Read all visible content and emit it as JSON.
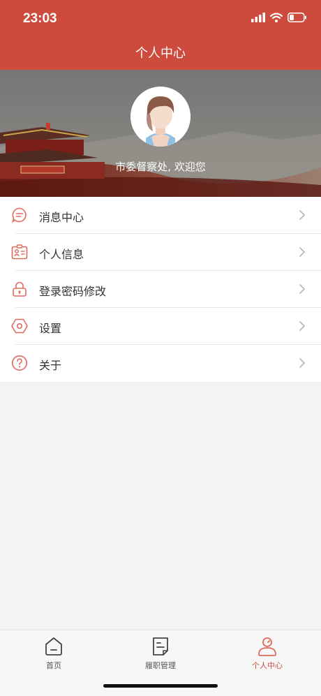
{
  "status_bar": {
    "time": "23:03"
  },
  "header": {
    "title": "个人中心"
  },
  "profile": {
    "welcome": "市委督察处, 欢迎您"
  },
  "menu": {
    "items": [
      {
        "label": "消息中心",
        "icon": "message-icon"
      },
      {
        "label": "个人信息",
        "icon": "id-card-icon"
      },
      {
        "label": "登录密码修改",
        "icon": "lock-icon"
      },
      {
        "label": "设置",
        "icon": "settings-icon"
      },
      {
        "label": "关于",
        "icon": "question-icon"
      }
    ]
  },
  "tabbar": {
    "tabs": [
      {
        "label": "首页",
        "icon": "home-icon"
      },
      {
        "label": "履职管理",
        "icon": "document-icon"
      },
      {
        "label": "个人中心",
        "icon": "user-icon",
        "active": true
      }
    ]
  },
  "colors": {
    "brand": "#cd4b3c",
    "accent_icon": "#e06a5e"
  }
}
